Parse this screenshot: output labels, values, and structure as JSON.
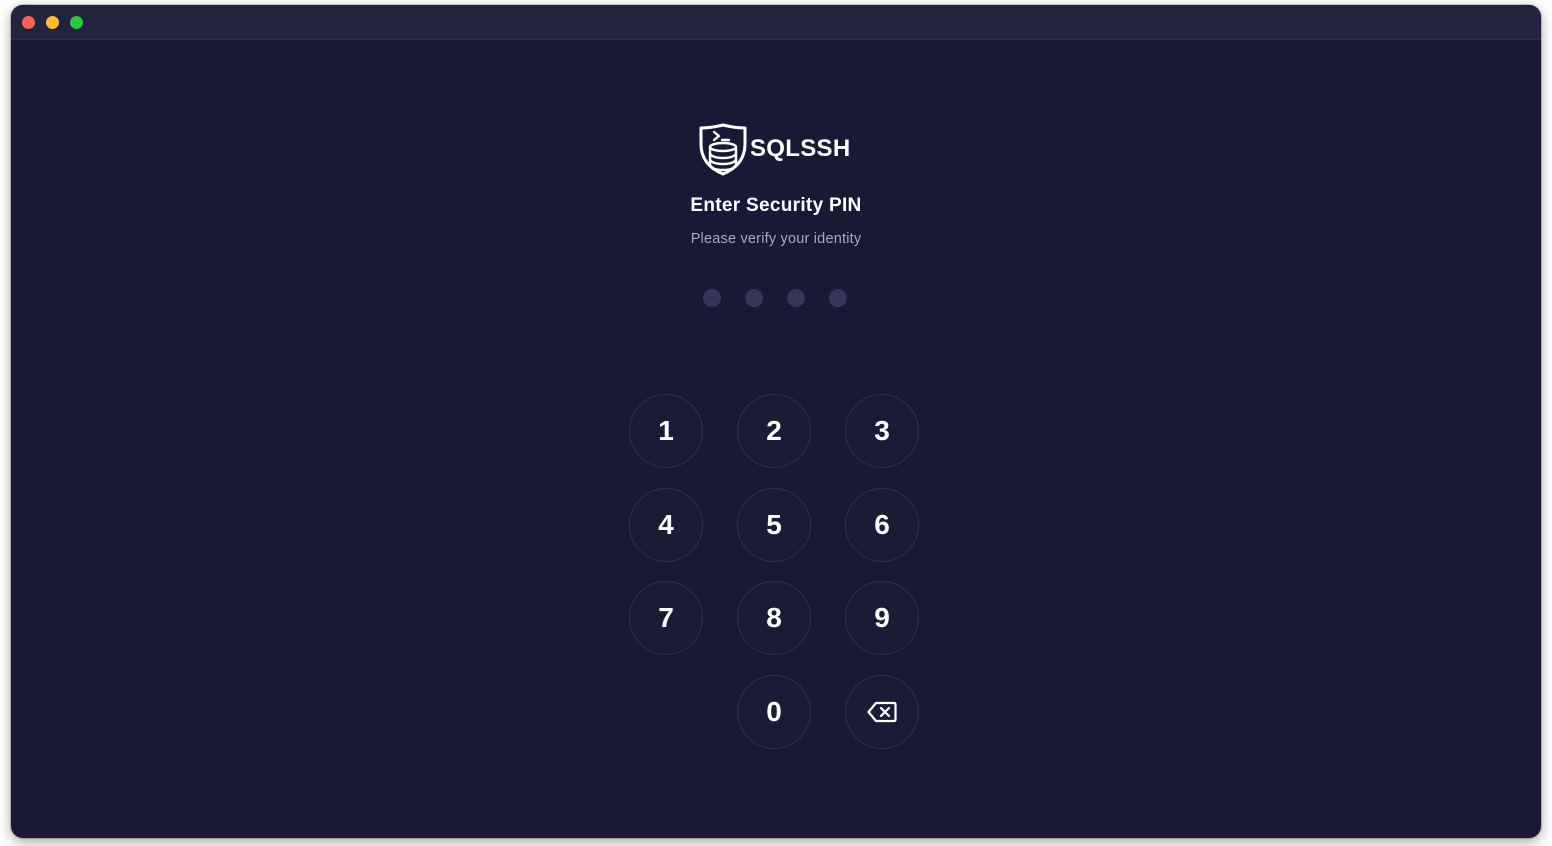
{
  "window": {
    "controls": [
      "close",
      "minimize",
      "maximize"
    ]
  },
  "brand": {
    "name": "SQLSSH",
    "logo_icon": "shield-database-terminal-icon"
  },
  "pin": {
    "title": "Enter Security PIN",
    "subtitle": "Please verify your identity",
    "digits_total": 4,
    "digits_entered": 0
  },
  "keypad": {
    "keys": [
      "1",
      "2",
      "3",
      "4",
      "5",
      "6",
      "7",
      "8",
      "9",
      "0"
    ],
    "backspace_icon": "backspace-icon"
  },
  "colors": {
    "background": "#181a35",
    "titlebar": "#22243f",
    "text_primary": "#ffffff",
    "text_secondary": "#a6a8bf",
    "pin_dot_empty": "#35375a",
    "key_border": "#2e3050"
  }
}
